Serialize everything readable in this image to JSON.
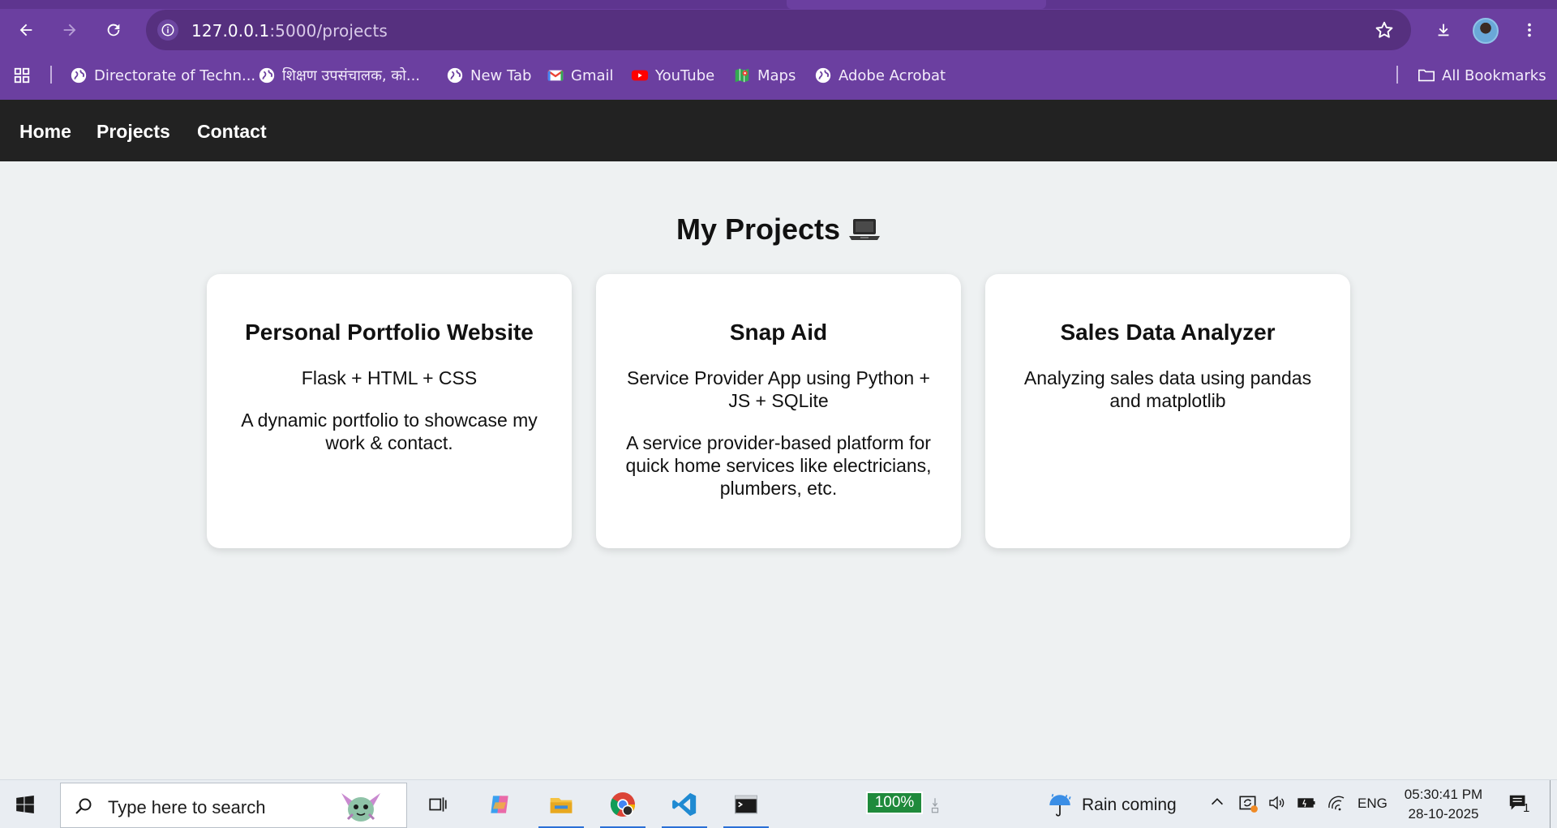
{
  "browser": {
    "url_host": "127.0.0.1",
    "url_path": ":5000/projects",
    "bookmarks": [
      {
        "label": "Directorate of Techn...",
        "icon": "globe-icon"
      },
      {
        "label": "शिक्षण उपसंचालक, को...",
        "icon": "globe-icon"
      },
      {
        "label": "New Tab",
        "icon": "globe-icon"
      },
      {
        "label": "Gmail",
        "icon": "gmail-icon"
      },
      {
        "label": "YouTube",
        "icon": "youtube-icon"
      },
      {
        "label": "Maps",
        "icon": "maps-icon"
      },
      {
        "label": "Adobe Acrobat",
        "icon": "globe-icon"
      }
    ],
    "all_bookmarks": "All Bookmarks",
    "accent": "#6b3fa0"
  },
  "site": {
    "nav": [
      "Home",
      "Projects",
      "Contact"
    ],
    "heading": "My Projects",
    "heading_emoji": "💻",
    "projects": [
      {
        "title": "Personal Portfolio Website",
        "tech": "Flask + HTML + CSS",
        "description": "A dynamic portfolio to showcase my work & contact."
      },
      {
        "title": "Snap Aid",
        "tech": "Service Provider App using Python + JS + SQLite",
        "description": "A service provider-based platform for quick home services like electricians, plumbers, etc."
      },
      {
        "title": "Sales Data Analyzer",
        "tech": "Analyzing sales data using pandas and matplotlib",
        "description": ""
      }
    ],
    "nav_bg": "#222222",
    "page_bg": "#eef1f2"
  },
  "taskbar": {
    "search_placeholder": "Type here to search",
    "battery_percent": "100%",
    "weather": "Rain coming",
    "language": "ENG",
    "time": "05:30:41 PM",
    "date": "28-10-2025",
    "notification_count": "1"
  }
}
